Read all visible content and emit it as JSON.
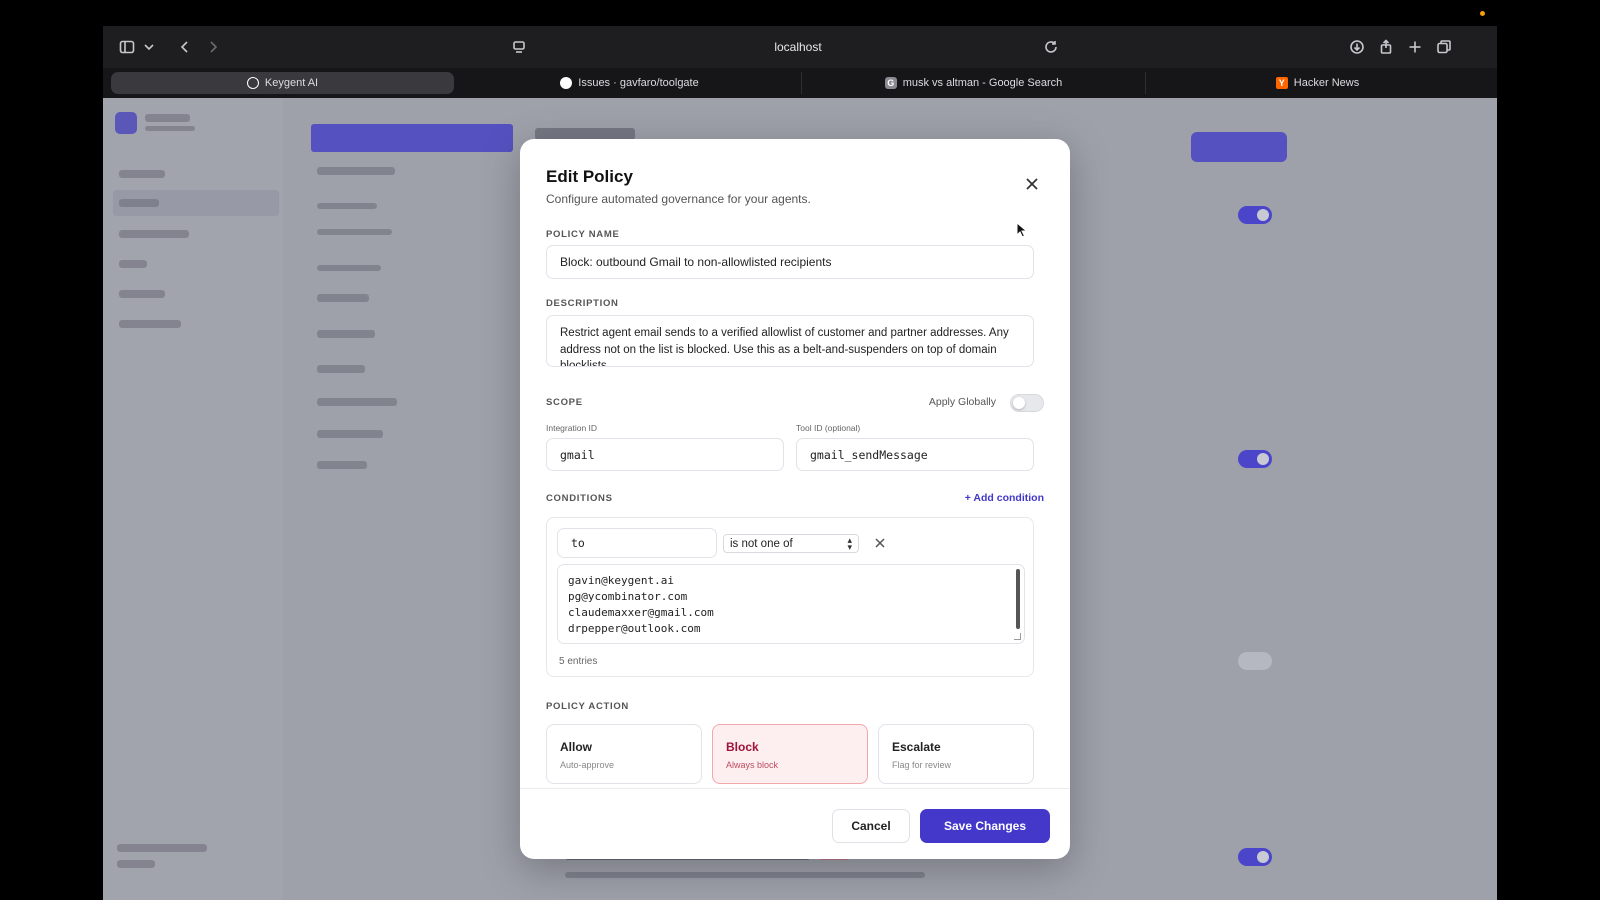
{
  "browser": {
    "url": "localhost",
    "tabs": [
      {
        "label": "Keygent AI",
        "icon": "keygent-icon",
        "active": true
      },
      {
        "label": "Issues · gavfaro/toolgate",
        "icon": "github-icon",
        "active": false
      },
      {
        "label": "musk vs altman - Google Search",
        "icon": "google-icon",
        "active": false
      },
      {
        "label": "Hacker News",
        "icon": "hacker-news-icon",
        "active": false
      }
    ]
  },
  "modal": {
    "title": "Edit Policy",
    "subtitle": "Configure automated governance for your agents.",
    "policy_name_label": "POLICY NAME",
    "policy_name_value": "Block: outbound Gmail to non-allowlisted recipients",
    "description_label": "DESCRIPTION",
    "description_value": "Restrict agent email sends to a verified allowlist of customer and partner addresses. Any address not on the list is blocked. Use this as a belt-and-suspenders on top of domain blocklists.",
    "scope_label": "SCOPE",
    "apply_globally_label": "Apply Globally",
    "apply_globally": false,
    "integration_id_label": "Integration ID",
    "integration_id_value": "gmail",
    "tool_id_label": "Tool ID (optional)",
    "tool_id_value": "gmail_sendMessage",
    "conditions_label": "CONDITIONS",
    "add_condition_label": "+ Add condition",
    "condition": {
      "field": "to",
      "operator": "is not one of",
      "values": [
        "gavin@keygent.ai",
        "pg@ycombinator.com",
        "claudemaxxer@gmail.com",
        "drpepper@outlook.com"
      ],
      "entries_label": "5 entries"
    },
    "policy_action_label": "POLICY ACTION",
    "actions": [
      {
        "title": "Allow",
        "subtitle": "Auto-approve",
        "selected": false
      },
      {
        "title": "Block",
        "subtitle": "Always block",
        "selected": true
      },
      {
        "title": "Escalate",
        "subtitle": "Flag for review",
        "selected": false
      }
    ],
    "cancel_label": "Cancel",
    "save_label": "Save Changes"
  },
  "colors": {
    "accent": "#4338ca",
    "block_bg": "#fdeff0",
    "block_text": "#9f1239"
  }
}
